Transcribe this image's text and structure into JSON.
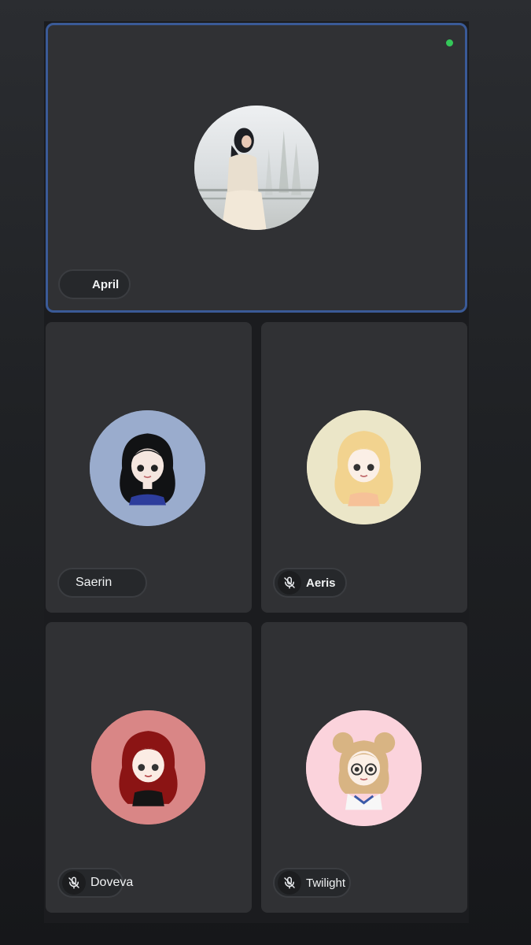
{
  "colors": {
    "active_border": "#3a5a97",
    "speaking_indicator": "#34c759",
    "tile_background": "#303134"
  },
  "participants": [
    {
      "name": "April",
      "muted": false,
      "speaking": true,
      "avatar": "photo-avatar",
      "avatar_bg": "#d9dde0"
    },
    {
      "name": "Saerin",
      "muted": false,
      "speaking": false,
      "avatar": "cartoon-avatar-black-hair",
      "avatar_bg": "#9aaccd"
    },
    {
      "name": "Aeris",
      "muted": true,
      "speaking": false,
      "avatar": "cartoon-avatar-blonde-hair",
      "avatar_bg": "#ebe6c8"
    },
    {
      "name": "Doveva",
      "muted": true,
      "speaking": false,
      "avatar": "cartoon-avatar-red-hair",
      "avatar_bg": "#d98686"
    },
    {
      "name": "Twilight",
      "muted": true,
      "speaking": false,
      "avatar": "cartoon-avatar-bun-hair-glasses",
      "avatar_bg": "#fbd3dc"
    }
  ]
}
